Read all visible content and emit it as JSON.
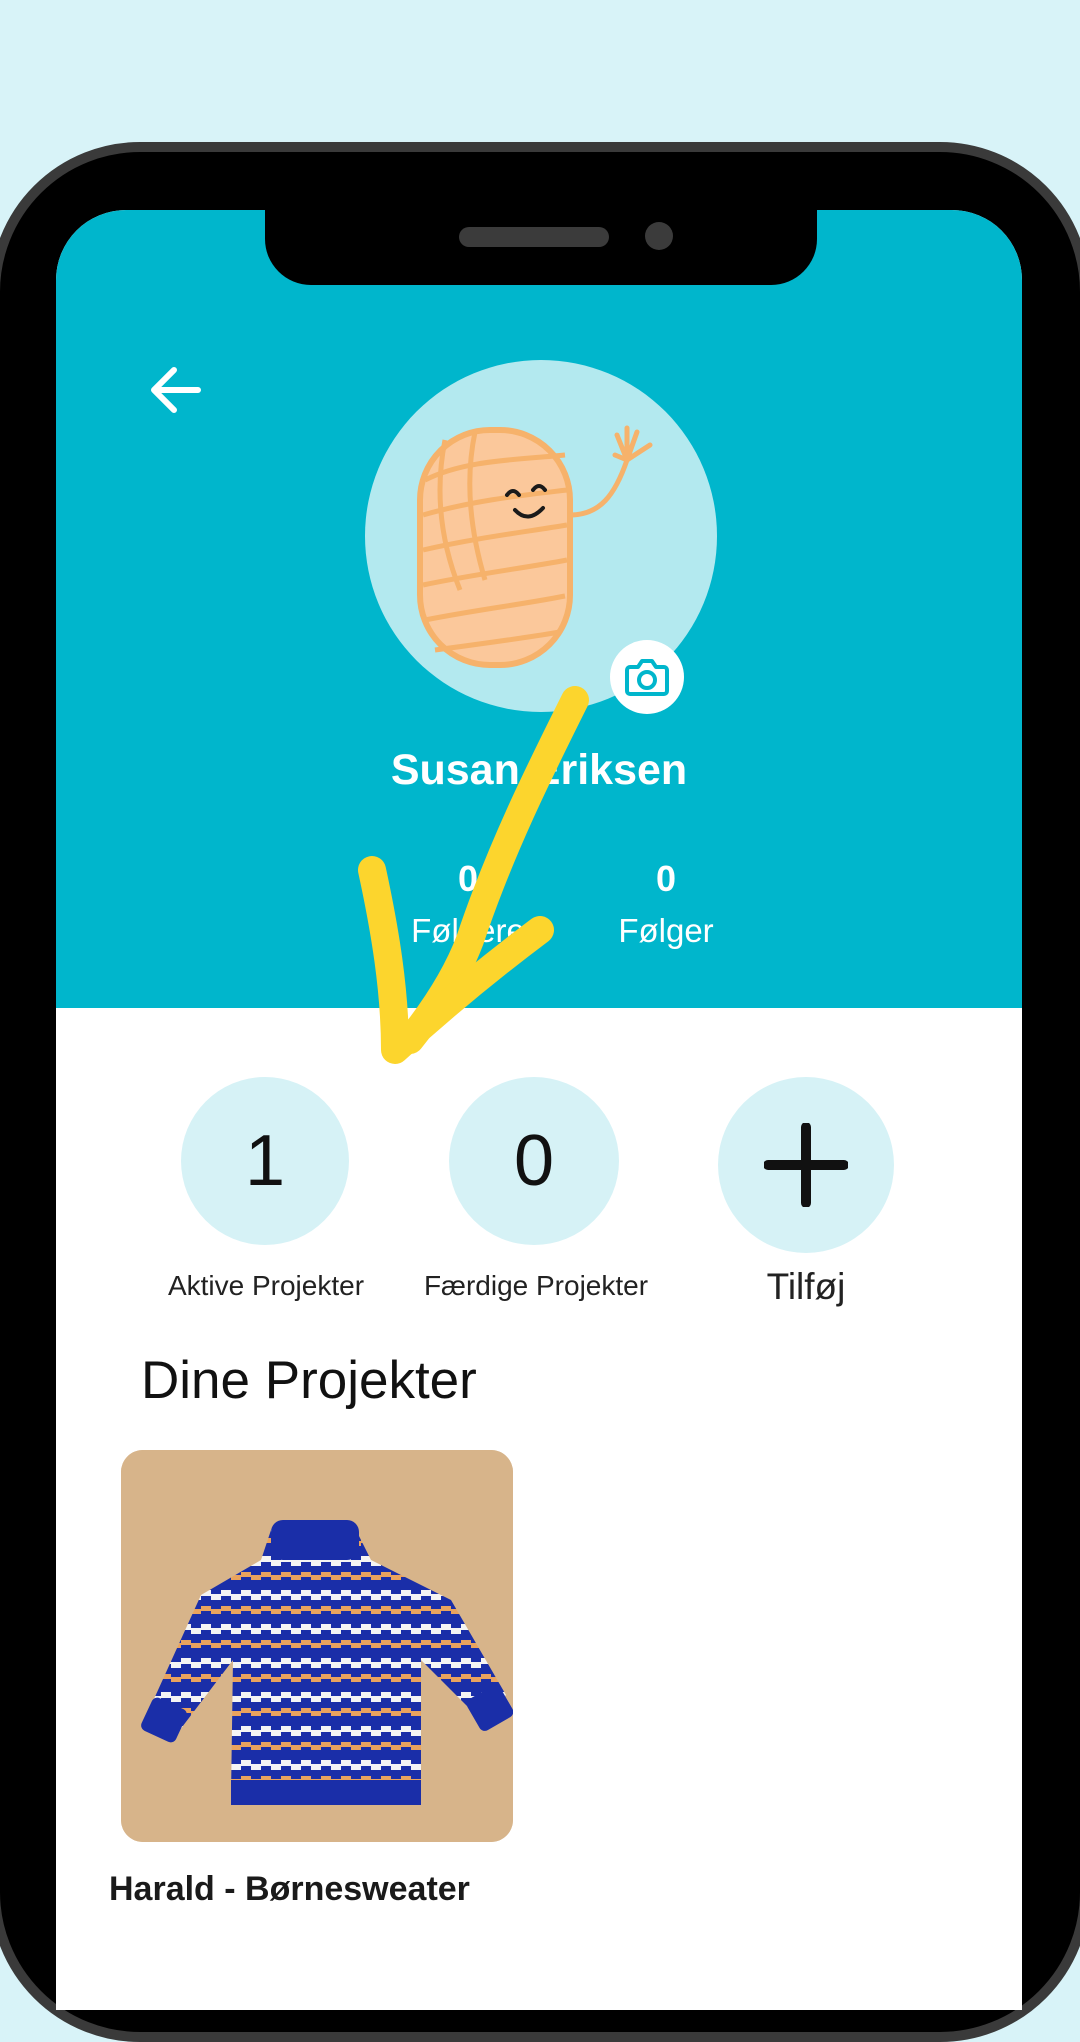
{
  "profile": {
    "name": "Susan Eriksen",
    "followers": {
      "count": "0",
      "label": "Følgere"
    },
    "following": {
      "count": "0",
      "label": "Følger"
    }
  },
  "stats": {
    "active": {
      "value": "1",
      "label": "Aktive Projekter"
    },
    "done": {
      "value": "0",
      "label": "Færdige Projekter"
    },
    "add": {
      "label": "Tilføj"
    }
  },
  "projects": {
    "section_title": "Dine Projekter",
    "items": [
      {
        "title": "Harald - Børnesweater"
      }
    ]
  },
  "colors": {
    "background": "#d8f3f8",
    "header": "#00b6cc",
    "circle": "#d6f2f6",
    "annotation_arrow": "#fcd52d"
  },
  "icons": [
    "back-arrow-icon",
    "camera-icon",
    "plus-icon",
    "yarn-mascot"
  ]
}
